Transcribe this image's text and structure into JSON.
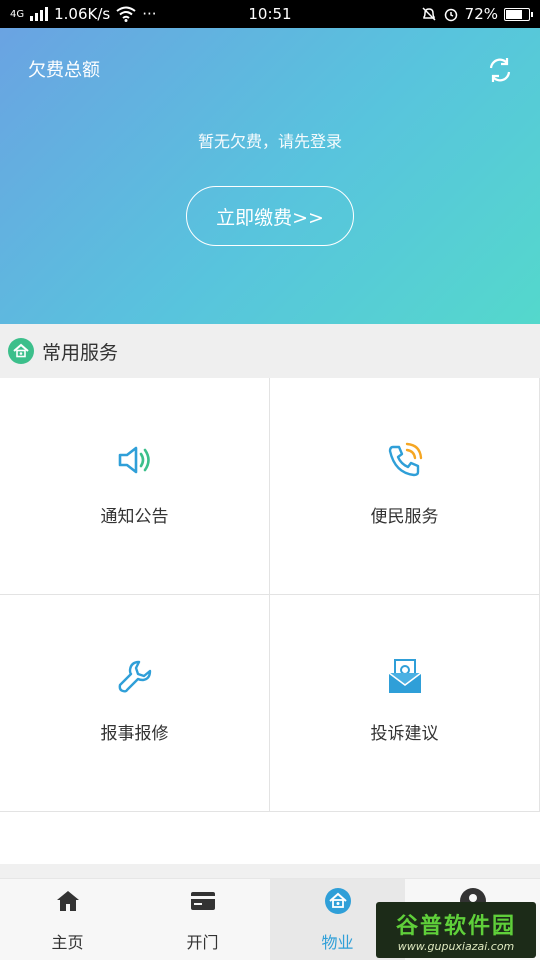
{
  "status_bar": {
    "network": "4G",
    "speed": "1.06K/s",
    "dots": "···",
    "time": "10:51",
    "battery": "72%",
    "battery_level": 0.72
  },
  "header": {
    "title": "欠费总额",
    "message": "暂无欠费，请先登录",
    "pay_button": "立即缴费>>"
  },
  "section": {
    "title": "常用服务"
  },
  "services": [
    {
      "label": "通知公告",
      "icon": "speaker-icon"
    },
    {
      "label": "便民服务",
      "icon": "phone-icon"
    },
    {
      "label": "报事报修",
      "icon": "wrench-icon"
    },
    {
      "label": "投诉建议",
      "icon": "envelope-icon"
    }
  ],
  "tabs": [
    {
      "label": "主页",
      "icon": "home-icon"
    },
    {
      "label": "开门",
      "icon": "card-icon"
    },
    {
      "label": "物业",
      "icon": "property-icon",
      "active": true
    },
    {
      "label": "",
      "icon": "user-icon"
    }
  ],
  "watermark": {
    "main": "谷普软件园",
    "sub": "www.gupuxiazai.com"
  },
  "colors": {
    "accent_blue": "#2f9fd8",
    "green": "#3cbf8b",
    "orange": "#f5a623"
  }
}
